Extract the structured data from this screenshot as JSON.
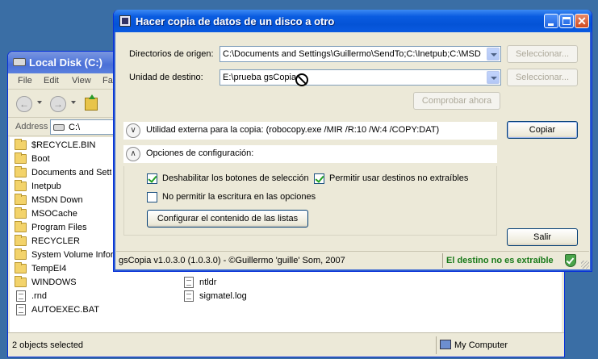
{
  "explorer": {
    "title": "Local Disk (C:)",
    "menu": [
      "File",
      "Edit",
      "View",
      "Fa"
    ],
    "address_label": "Address",
    "address_value": "C:\\",
    "folders": [
      "$RECYCLE.BIN",
      "Boot",
      "Documents and Settings",
      "Inetpub",
      "MSDN Down",
      "MSOCache",
      "Program Files",
      "RECYCLER",
      "System Volume Informa",
      "TempEI4",
      "WINDOWS"
    ],
    "files_left": [
      ".rnd",
      "AUTOEXEC.BAT"
    ],
    "files_right": [
      "ntldr",
      "sigmatel.log"
    ],
    "status_left": "2 objects selected",
    "status_right": "My Computer"
  },
  "dialog": {
    "title": "Hacer copia de datos de un disco a otro",
    "origin_label": "Directorios de origen:",
    "origin_value": "C:\\Documents and Settings\\Guillermo\\SendTo;C:\\Inetpub;C:\\MSD",
    "dest_label": "Unidad de destino:",
    "dest_value": "E:\\prueba gsCopia",
    "select_btn_1": "Seleccionar...",
    "select_btn_2": "Seleccionar...",
    "check_now_btn": "Comprobar ahora",
    "utility_text": "Utilidad externa para la copia: (robocopy.exe /MIR /R:10 /W:4 /COPY:DAT)",
    "copy_btn": "Copiar",
    "options_header": "Opciones de configuración:",
    "opt_disable_buttons": "Deshabilitar los botones de selección",
    "opt_disable_buttons_checked": true,
    "opt_non_removable": "Permitir usar destinos no extraíbles",
    "opt_non_removable_checked": true,
    "opt_no_write": "No permitir la escritura en las opciones",
    "opt_no_write_checked": false,
    "configure_lists_btn": "Configurar el contenido de las listas",
    "exit_btn": "Salir",
    "status_version": "gsCopia v1.0.3.0 (1.0.3.0) - ©Guillermo 'guille' Som, 2007",
    "status_dest": "El destino no es extraíble",
    "status_color": "#1a7a1a"
  }
}
